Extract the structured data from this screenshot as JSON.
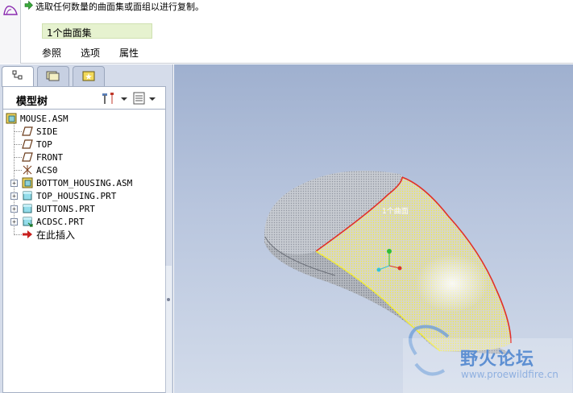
{
  "dashboard": {
    "prompt": "选取任何数量的曲面集或面组以进行复制。",
    "collector_value": "1个曲面集",
    "tabs": [
      "参照",
      "选项",
      "属性"
    ]
  },
  "navigator": {
    "tabs": [
      {
        "name": "model-tree-tab",
        "icon": "model-tree-icon"
      },
      {
        "name": "folder-browser-tab",
        "icon": "folder-icon"
      },
      {
        "name": "favorites-tab",
        "icon": "favorites-icon"
      }
    ],
    "title": "模型树"
  },
  "tree": {
    "root": "MOUSE.ASM",
    "items": [
      {
        "label": "SIDE",
        "icon": "datum-plane-icon"
      },
      {
        "label": "TOP",
        "icon": "datum-plane-icon"
      },
      {
        "label": "FRONT",
        "icon": "datum-plane-icon"
      },
      {
        "label": "ACS0",
        "icon": "coordinate-system-icon"
      },
      {
        "label": "BOTTOM_HOUSING.ASM",
        "icon": "assembly-icon",
        "expandable": true
      },
      {
        "label": "TOP_HOUSING.PRT",
        "icon": "part-icon",
        "expandable": true
      },
      {
        "label": "BUTTONS.PRT",
        "icon": "part-icon",
        "expandable": true
      },
      {
        "label": "ACDSC.PRT",
        "icon": "part-icon",
        "expandable": true
      },
      {
        "label": "在此插入",
        "icon": "insert-here-icon"
      }
    ]
  },
  "viewport": {
    "selection_label": "1个曲面",
    "watermark_brand": "野火论坛",
    "watermark_url": "www.proewildfire.cn"
  },
  "colors": {
    "accent_green": "#e6f2cf",
    "viewport_top": "#9fb0cf",
    "highlight_yellow": "#f2ec3a",
    "edge_red": "#e0302a"
  }
}
